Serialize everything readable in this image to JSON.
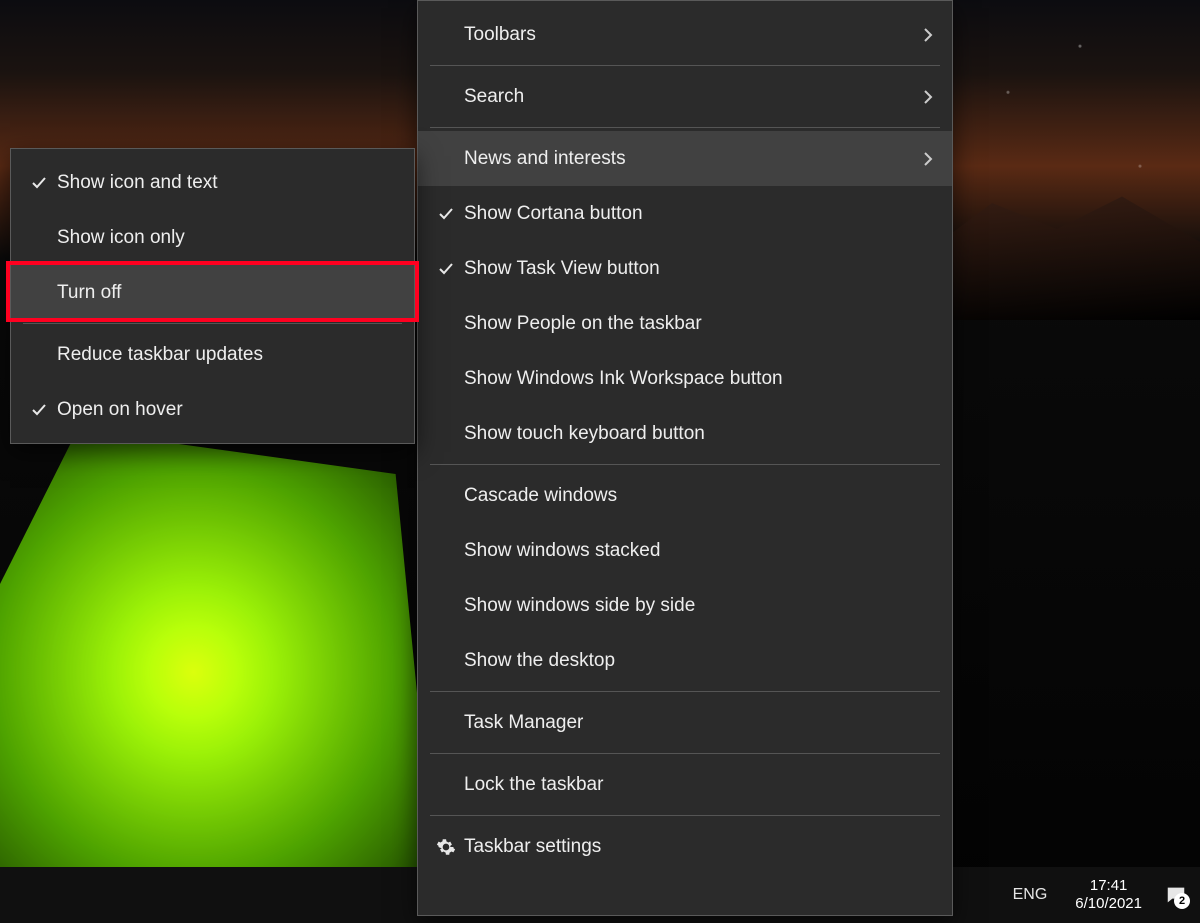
{
  "colors": {
    "highlight": "#ff0020",
    "menu_bg": "#2b2b2b",
    "menu_hover": "#414141"
  },
  "main_menu": {
    "items": [
      {
        "label": "Toolbars",
        "checked": false,
        "submenu": true,
        "icon": null
      },
      {
        "label": "Search",
        "checked": false,
        "submenu": true,
        "icon": null
      },
      {
        "label": "News and interests",
        "checked": false,
        "submenu": true,
        "icon": null,
        "hovered": true
      },
      {
        "label": "Show Cortana button",
        "checked": true,
        "submenu": false,
        "icon": null
      },
      {
        "label": "Show Task View button",
        "checked": true,
        "submenu": false,
        "icon": null
      },
      {
        "label": "Show People on the taskbar",
        "checked": false,
        "submenu": false,
        "icon": null
      },
      {
        "label": "Show Windows Ink Workspace button",
        "checked": false,
        "submenu": false,
        "icon": null
      },
      {
        "label": "Show touch keyboard button",
        "checked": false,
        "submenu": false,
        "icon": null
      },
      {
        "label": "Cascade windows",
        "checked": false,
        "submenu": false,
        "icon": null
      },
      {
        "label": "Show windows stacked",
        "checked": false,
        "submenu": false,
        "icon": null
      },
      {
        "label": "Show windows side by side",
        "checked": false,
        "submenu": false,
        "icon": null
      },
      {
        "label": "Show the desktop",
        "checked": false,
        "submenu": false,
        "icon": null
      },
      {
        "label": "Task Manager",
        "checked": false,
        "submenu": false,
        "icon": null
      },
      {
        "label": "Lock the taskbar",
        "checked": false,
        "submenu": false,
        "icon": null
      },
      {
        "label": "Taskbar settings",
        "checked": false,
        "submenu": false,
        "icon": "gear"
      }
    ],
    "separators_after": [
      1,
      7,
      11,
      12,
      13
    ]
  },
  "sub_menu": {
    "items": [
      {
        "label": "Show icon and text",
        "checked": true
      },
      {
        "label": "Show icon only",
        "checked": false
      },
      {
        "label": "Turn off",
        "checked": false,
        "hovered": true,
        "highlighted": true
      },
      {
        "label": "Reduce taskbar updates",
        "checked": false
      },
      {
        "label": "Open on hover",
        "checked": true
      }
    ],
    "separators_after": [
      2
    ]
  },
  "taskbar": {
    "language": "ENG",
    "time": "17:41",
    "date": "6/10/2021",
    "notifications": "2"
  }
}
